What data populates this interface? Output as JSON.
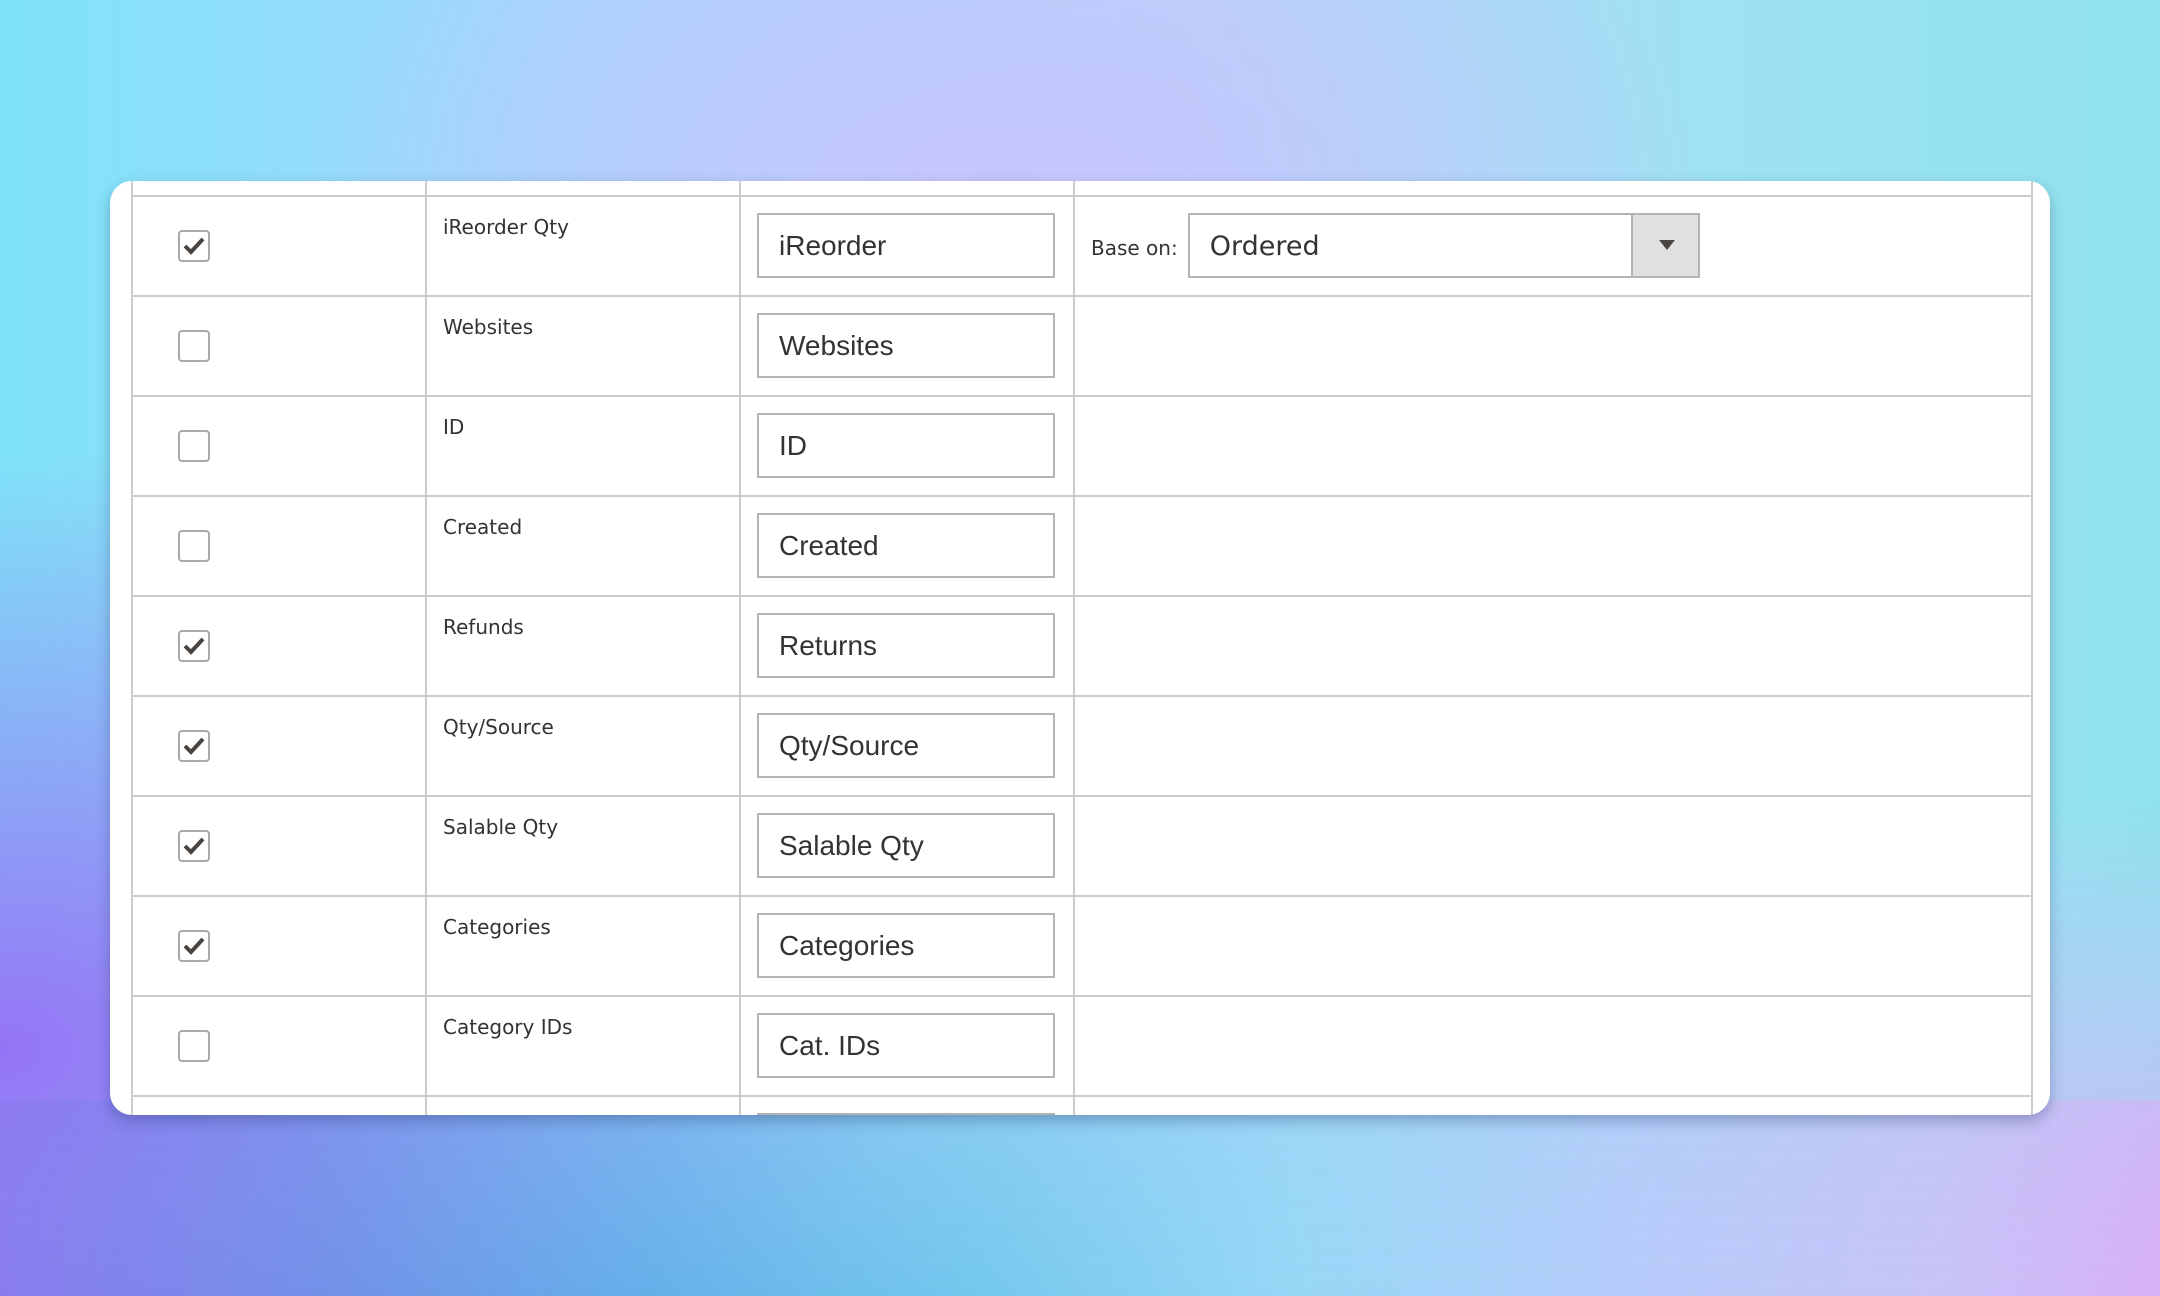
{
  "columns_settings": {
    "rows": [
      {
        "checked": true,
        "field_label": "iReorder Qty",
        "title_value": "iReorder",
        "extra": {
          "label": "Base on:",
          "selected": "Ordered"
        }
      },
      {
        "checked": false,
        "field_label": "Websites",
        "title_value": "Websites"
      },
      {
        "checked": false,
        "field_label": "ID",
        "title_value": "ID"
      },
      {
        "checked": false,
        "field_label": "Created",
        "title_value": "Created"
      },
      {
        "checked": true,
        "field_label": "Refunds",
        "title_value": "Returns"
      },
      {
        "checked": true,
        "field_label": "Qty/Source",
        "title_value": "Qty/Source"
      },
      {
        "checked": true,
        "field_label": "Salable Qty",
        "title_value": "Salable Qty"
      },
      {
        "checked": true,
        "field_label": "Categories",
        "title_value": "Categories"
      },
      {
        "checked": false,
        "field_label": "Category IDs",
        "title_value": "Cat. IDs"
      }
    ]
  },
  "icons": {
    "checkmark": "checkmark-icon",
    "dropdown": "triangle-down-icon"
  },
  "colors": {
    "text": "#333333",
    "border": "#cccccc",
    "checkmark": "#4a4440",
    "select_button_bg": "#e0e0e0"
  }
}
